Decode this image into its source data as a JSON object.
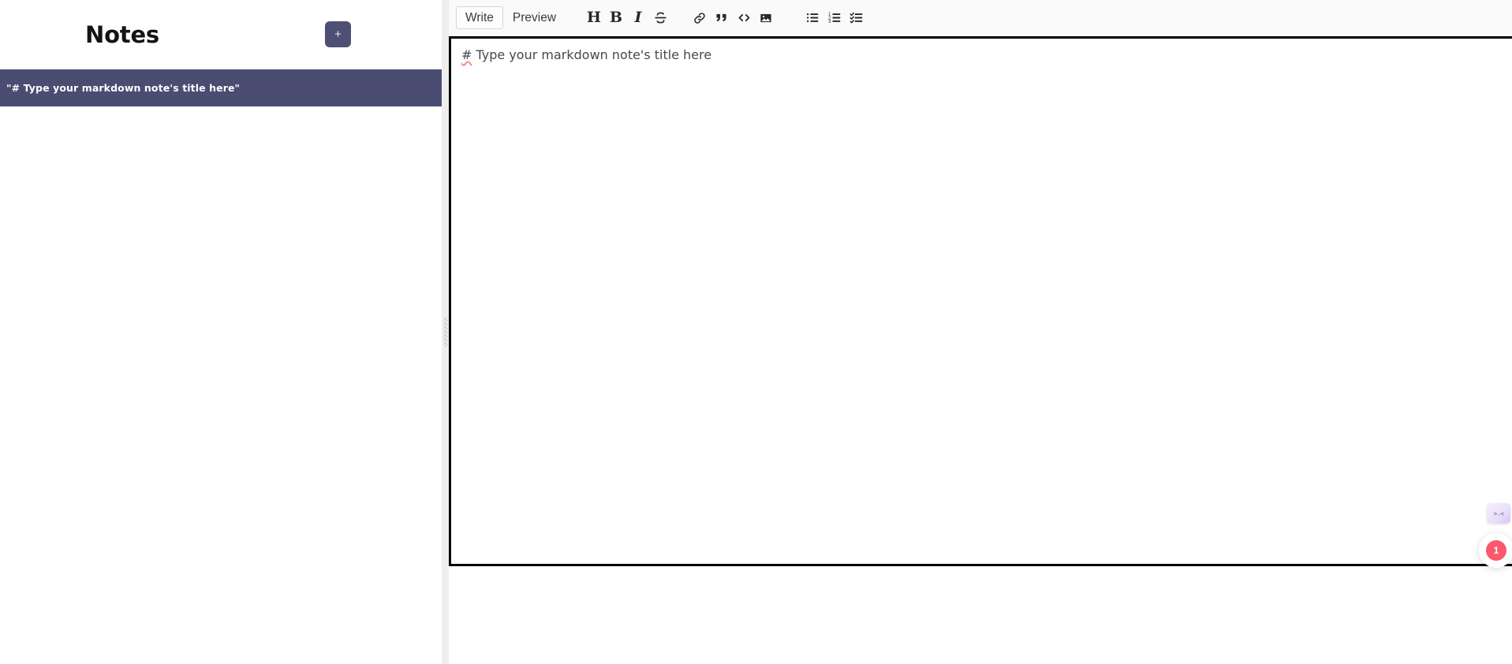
{
  "sidebar": {
    "title": "Notes",
    "add_button_label": "+",
    "notes": [
      {
        "title": "\"# Type your markdown note's title here\"",
        "selected": true
      }
    ]
  },
  "editor": {
    "tabs": [
      {
        "label": "Write",
        "active": true
      },
      {
        "label": "Preview",
        "active": false
      }
    ],
    "toolbar_buttons": [
      {
        "name": "heading-icon",
        "glyph": "H",
        "title": "Add header text"
      },
      {
        "name": "bold-icon",
        "glyph": "B",
        "title": "Add bold text"
      },
      {
        "name": "italic-icon",
        "glyph": "I",
        "title": "Add italic text"
      },
      {
        "name": "strikethrough-icon",
        "glyph": "S",
        "title": "Add strikethrough text"
      },
      {
        "name": "link-icon",
        "glyph": "",
        "title": "Add a link"
      },
      {
        "name": "quote-icon",
        "glyph": "”",
        "title": "Insert a quote"
      },
      {
        "name": "code-icon",
        "glyph": "</>",
        "title": "Insert code"
      },
      {
        "name": "image-icon",
        "glyph": "",
        "title": "Add an image"
      },
      {
        "name": "unordered-list-icon",
        "glyph": "",
        "title": "Add a bulleted list"
      },
      {
        "name": "ordered-list-icon",
        "glyph": "",
        "title": "Add a numbered list"
      },
      {
        "name": "task-list-icon",
        "glyph": "",
        "title": "Add a task list"
      }
    ],
    "content_prefix": "#",
    "content_rest": " Type your markdown note's title here",
    "placeholder": "Type your markdown note's title here"
  },
  "widgets": {
    "chat_face": ">.<",
    "launcher_badge_count": "1"
  },
  "colors": {
    "accent": "#4a4c72",
    "badge": "#f9596a",
    "editor_border": "#000000",
    "toolbar_bg": "#fafafa",
    "splitter_bg": "#eeeeee"
  }
}
